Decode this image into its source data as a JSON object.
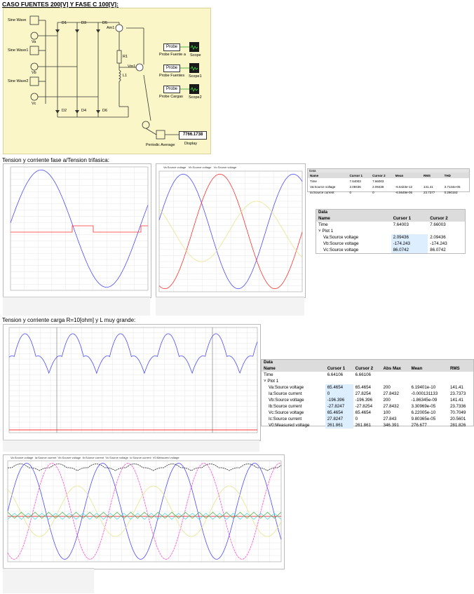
{
  "title": "CASO FUENTES 200[V] Y FASE C 100[V]:",
  "schematic": {
    "sources": [
      "Sine Wave",
      "Sine Wave1",
      "Sine Wave2"
    ],
    "source_labels": [
      "Va",
      "Vb",
      "Vc"
    ],
    "diodes": [
      "D1",
      "D2",
      "D3",
      "D4",
      "D5",
      "D6"
    ],
    "ammeter": "Am1",
    "voltmeter": "Vm1",
    "resistor": "R1",
    "inductor": "L1",
    "probes": [
      {
        "block": "Probe",
        "label": "Probe Fuente a",
        "scope": "Scope"
      },
      {
        "block": "Probe",
        "label": "Probe Fuentes",
        "scope": "Scope1"
      },
      {
        "block": "Probe",
        "label": "Probe Cargas",
        "scope": "Scope2"
      }
    ],
    "periodic_average": "Periodic Average",
    "display_value": "7766.1738",
    "display_label": "Display"
  },
  "section2_heading": "Tension y corriente fase a/Tension trifasica:",
  "section3_heading": "Tension y corriente carga R=10[ohm] y L muy grande:",
  "colors": {
    "blue": "#4b4bff",
    "red": "#ff3030",
    "yellow": "#e8e48c",
    "pink": "#ff4fd0",
    "cyan": "#3fd9e8",
    "green": "#3aa83a",
    "black": "#222222"
  },
  "table_small_top": {
    "header": [
      "Name",
      "Cursor 1",
      "Cursor 2",
      "Mean",
      "RMS",
      "THD"
    ],
    "rows": [
      [
        "Time",
        "7.64003",
        "7.66003",
        "",
        "",
        ""
      ],
      [
        "Va:Source voltage",
        "2.09436",
        "2.09436",
        "-6.5423e-12",
        "141.41",
        "3.7134e-05"
      ],
      [
        "Ia:Source current",
        "0",
        "0",
        "-6.5649e-05",
        "23.7377",
        "0.290153"
      ]
    ]
  },
  "table_a": {
    "title": "Data",
    "header": [
      "Name",
      "Cursor 1",
      "Cursor 2"
    ],
    "time": [
      "Time",
      "7.64003",
      "7.66003"
    ],
    "plot": "Plot 1",
    "rows": [
      [
        "Va:Source voltage",
        "2.09436",
        "2.09436"
      ],
      [
        "Vb:Source voltage",
        "-174.243",
        "-174.243"
      ],
      [
        "Vc:Source voltage",
        "86.0742",
        "86.0742"
      ]
    ]
  },
  "table_b": {
    "title": "Data",
    "header": [
      "Name",
      "Cursor 1",
      "Cursor 2",
      "Abs Max",
      "Mean",
      "RMS"
    ],
    "time": [
      "Time",
      "6.64106",
      "6.66106",
      "",
      "",
      ""
    ],
    "plot": "Plot 1",
    "rows": [
      [
        "Va:Source voltage",
        "65.4654",
        "65.4654",
        "200",
        "6.19401e-10",
        "141.41"
      ],
      [
        "Ia:Source current",
        "0",
        "27.8254",
        "27.8432",
        "-0.000131133",
        "23.7373"
      ],
      [
        "Vb:Source voltage",
        "-196.396",
        "-196.396",
        "200",
        "-1.86345e-09",
        "141.41"
      ],
      [
        "Ib:Source current",
        "-27.8247",
        "-27.8254",
        "27.8432",
        "3.30969e-05",
        "23.7336"
      ],
      [
        "Vc:Source voltage",
        "65.4654",
        "65.4654",
        "100",
        "6.22005e-10",
        "70.7049"
      ],
      [
        "Ic:Source current",
        "27.8247",
        "0",
        "27.843",
        "9.80365e-05",
        "20.5601"
      ],
      [
        "V0:Measured voltage",
        "261.861",
        "261.861",
        "346.391",
        "276.677",
        "281.826"
      ]
    ]
  },
  "legend_top": [
    "Va:Source voltage",
    "Vb:Source voltage",
    "Vc:Source voltage"
  ],
  "legend_bottom": [
    "Va:Source voltage",
    "Ia:Source current",
    "Vb:Source voltage",
    "Ib:Source current",
    "Vc:Source voltage",
    "Ic:Source current",
    "V0:Measured voltage"
  ]
}
